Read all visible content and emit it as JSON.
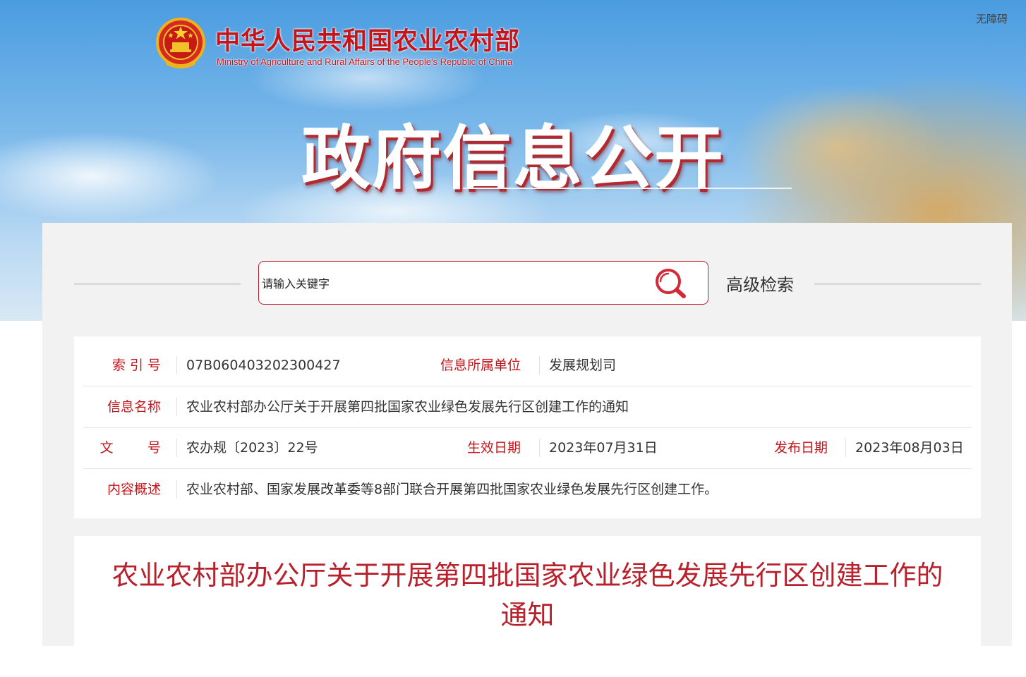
{
  "header": {
    "accessibility_label": "无障碍",
    "site_name_cn": "中华人民共和国农业农村部",
    "site_name_en": "Ministry of Agriculture and Rural Affairs of the People's Republic of China",
    "section_title": "政府信息公开"
  },
  "search": {
    "placeholder": "请输入关键字",
    "value": "",
    "advanced_label": "高级检索"
  },
  "meta": {
    "index_label": "索 引 号",
    "index_value": "07B060403202300427",
    "unit_label": "信息所属单位",
    "unit_value": "发展规划司",
    "name_label": "信息名称",
    "name_value": "农业农村部办公厅关于开展第四批国家农业绿色发展先行区创建工作的通知",
    "docno_label": "文        号",
    "docno_value": "农办规〔2023〕22号",
    "effective_label": "生效日期",
    "effective_value": "2023年07月31日",
    "published_label": "发布日期",
    "published_value": "2023年08月03日",
    "summary_label": "内容概述",
    "summary_value": "农业农村部、国家发展改革委等8部门联合开展第四批国家农业绿色发展先行区创建工作。"
  },
  "document": {
    "title": "农业农村部办公厅关于开展第四批国家农业绿色发展先行区创建工作的通知"
  },
  "colors": {
    "brand_red": "#c7141b",
    "panel_bg": "#f2f2f2"
  },
  "icons": {
    "search": "search-icon",
    "emblem": "national-emblem-icon"
  }
}
